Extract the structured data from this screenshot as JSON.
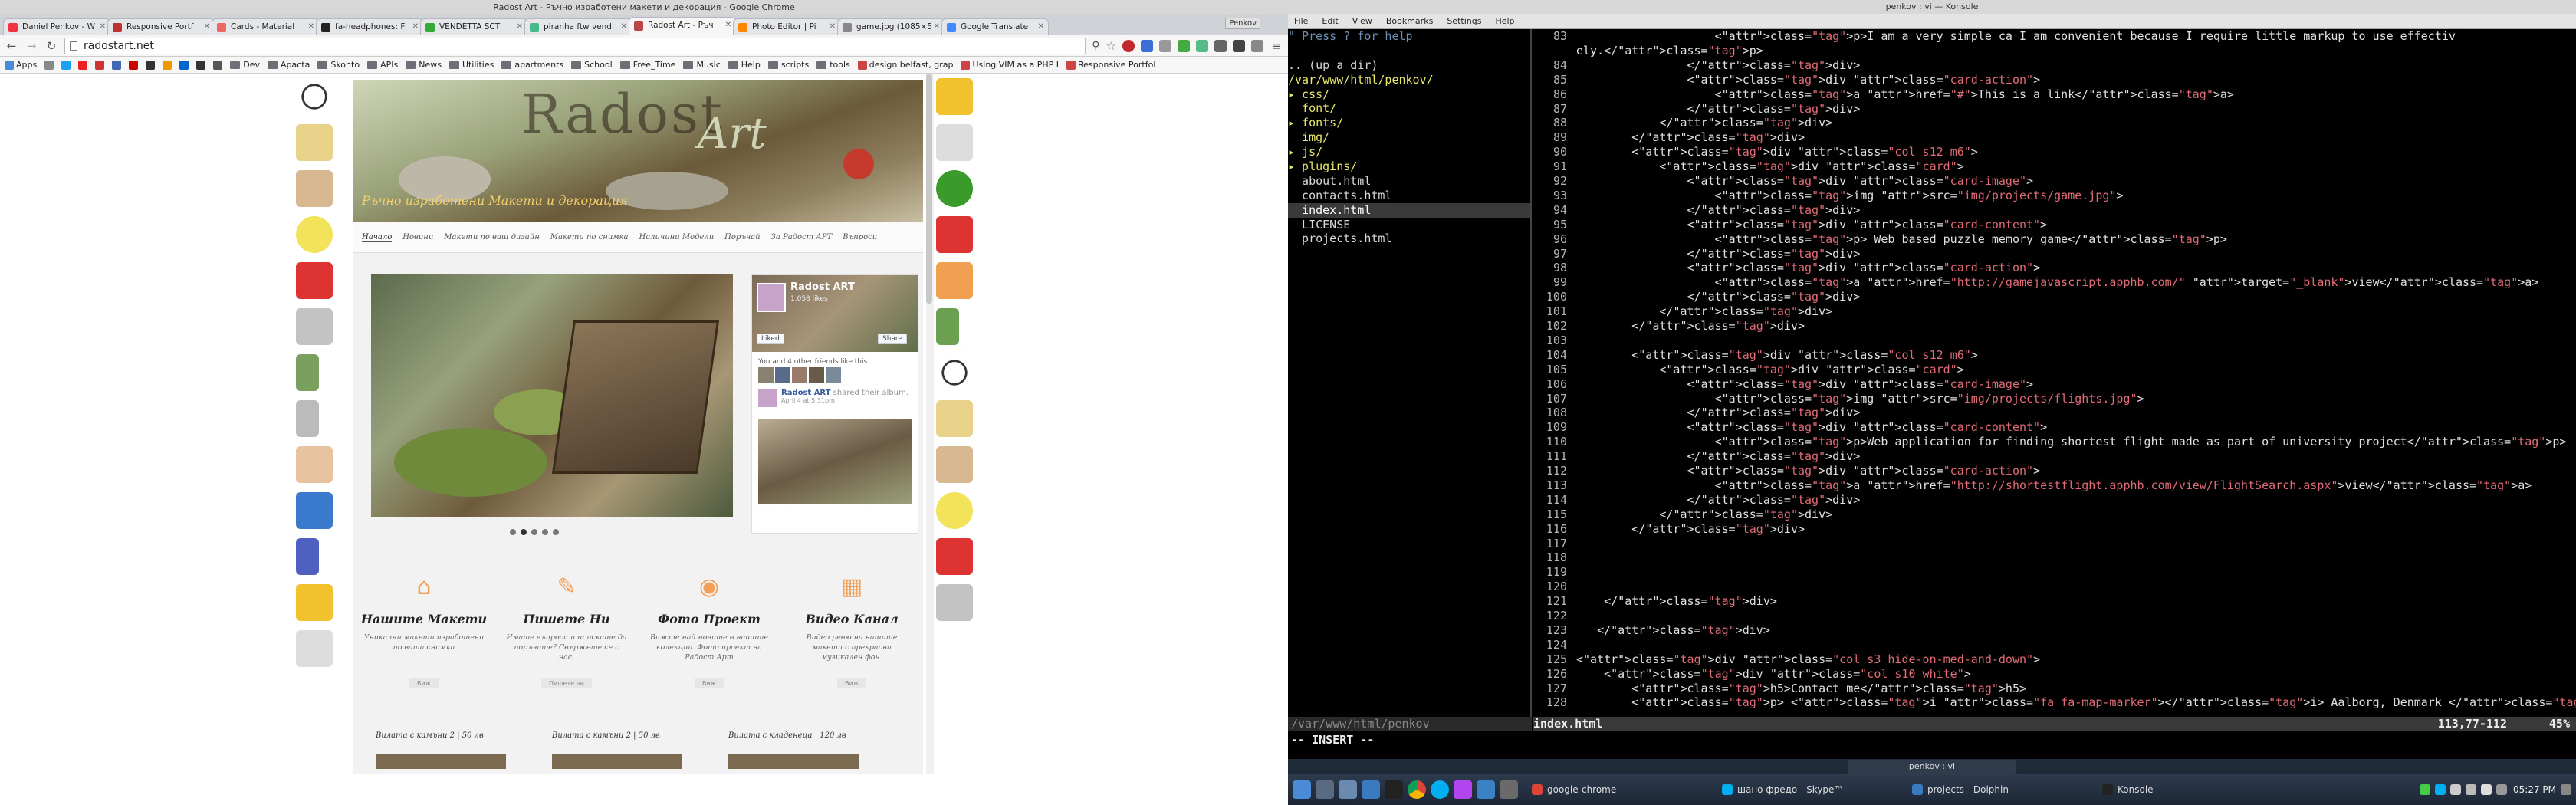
{
  "chrome": {
    "window_title": "Radost Art - Ръчно изработени макети и декорация - Google Chrome",
    "tabs": [
      {
        "label": "Daniel Penkov - W",
        "color": "#e34"
      },
      {
        "label": "Responsive Portf",
        "color": "#b33"
      },
      {
        "label": "Cards - Material",
        "color": "#e66"
      },
      {
        "label": "fa-headphones: F",
        "color": "#222"
      },
      {
        "label": "VENDETTA SCT",
        "color": "#3a3"
      },
      {
        "label": "piranha ftw vendi",
        "color": "#4b8"
      },
      {
        "label": "Radost Art - Ръч",
        "color": "#b44",
        "active": true
      },
      {
        "label": "Photo Editor | Pi",
        "color": "#f80"
      },
      {
        "label": "game.jpg (1085×5",
        "color": "#888"
      },
      {
        "label": "Google Translate",
        "color": "#48f"
      }
    ],
    "user_chip": "Penkov",
    "url": "radostart.net",
    "bookmarks": [
      "Apps",
      "Dev",
      "Apacta",
      "Skonto",
      "APIs",
      "News",
      "Utilities",
      "apartments",
      "School",
      "Free_Time",
      "Music",
      "Help",
      "scripts",
      "tools",
      "design belfast, grap",
      "Using VIM as a PHP I",
      "Responsive Portfol"
    ]
  },
  "site": {
    "brand": "Radost",
    "brand_art": "Art",
    "tagline": "Ръчно изработени Макети и декорация",
    "nav": [
      "Начало",
      "Новини",
      "Макети по ваш дизайн",
      "Макети по снимка",
      "Наличини Модели",
      "Поръчай",
      "За Радост АРТ",
      "Въпроси"
    ],
    "facebook": {
      "page_name": "Radost ART",
      "likes": "1,058 likes",
      "like_btn": "Liked",
      "share_btn": "Share",
      "friends_text": "You and 4 other friends like this",
      "post_author": "Radost ART",
      "post_action": "shared their album.",
      "post_time": "April 4 at 5:31pm"
    },
    "features": [
      {
        "icon": "home-icon",
        "title": "Нашите Макети",
        "text": "Уникални макети изработени по ваша снимка",
        "more": "Виж"
      },
      {
        "icon": "pencil-icon",
        "title": "Пишете Ни",
        "text": "Имате въпроси или искате да поръчате? Свържете се с нас.",
        "more": "Пишете ни"
      },
      {
        "icon": "camera-icon",
        "title": "Фото Проект",
        "text": "Вижте най новите в нашите колекции. Фото проект на Радост Арт",
        "more": "Виж"
      },
      {
        "icon": "film-icon",
        "title": "Видео Канал",
        "text": "Видео ревю на нашите макети с прекрасна музикален фон.",
        "more": "Виж"
      }
    ],
    "products": [
      "Вилата с камъни 2 | 50 лв",
      "Вилата с камъни 2 | 50 лв",
      "Вилата с кладенеца | 120 лв"
    ]
  },
  "konsole": {
    "window_title": "penkov : vi — Konsole",
    "menu": [
      "File",
      "Edit",
      "View",
      "Bookmarks",
      "Settings",
      "Help"
    ],
    "tree": [
      {
        "text": "\" Press ? for help",
        "cls": "comment"
      },
      {
        "text": "",
        "cls": "plain"
      },
      {
        "text": ".. (up a dir)",
        "cls": "plain"
      },
      {
        "text": "/var/www/html/penkov/",
        "cls": "dir"
      },
      {
        "text": "▸ css/",
        "cls": "dir"
      },
      {
        "text": "  font/",
        "cls": "dir"
      },
      {
        "text": "▸ fonts/",
        "cls": "dir"
      },
      {
        "text": "  img/",
        "cls": "dir"
      },
      {
        "text": "▸ js/",
        "cls": "dir"
      },
      {
        "text": "▸ plugins/",
        "cls": "dir"
      },
      {
        "text": "  about.html",
        "cls": "plain"
      },
      {
        "text": "  contacts.html",
        "cls": "plain"
      },
      {
        "text": "  index.html",
        "cls": "sel"
      },
      {
        "text": "  LICENSE",
        "cls": "plain"
      },
      {
        "text": "  projects.html",
        "cls": "plain"
      }
    ],
    "code_lines": [
      {
        "n": "83",
        "t": "                    <p>I am a very simple ca I am convenient because I require little markup to use effectiv"
      },
      {
        "n": "",
        "t": "ely.</p>"
      },
      {
        "n": "84",
        "t": "                </div>"
      },
      {
        "n": "85",
        "t": "                <div class=\"card-action\">"
      },
      {
        "n": "86",
        "t": "                    <a href=\"#\">This is a link</a>"
      },
      {
        "n": "87",
        "t": "                </div>"
      },
      {
        "n": "88",
        "t": "            </div>"
      },
      {
        "n": "89",
        "t": "        </div>"
      },
      {
        "n": "90",
        "t": "        <div class=\"col s12 m6\">"
      },
      {
        "n": "91",
        "t": "            <div class=\"card\">"
      },
      {
        "n": "92",
        "t": "                <div class=\"card-image\">"
      },
      {
        "n": "93",
        "t": "                    <img src=\"img/projects/game.jpg\">"
      },
      {
        "n": "94",
        "t": "                </div>"
      },
      {
        "n": "95",
        "t": "                <div class=\"card-content\">"
      },
      {
        "n": "96",
        "t": "                    <p> Web based puzzle memory game</p>"
      },
      {
        "n": "97",
        "t": "                </div>"
      },
      {
        "n": "98",
        "t": "                <div class=\"card-action\">"
      },
      {
        "n": "99",
        "t": "                    <a href=\"http://gamejavascript.apphb.com/\" target=\"_blank\">view</a>"
      },
      {
        "n": "100",
        "t": "                </div>"
      },
      {
        "n": "101",
        "t": "            </div>"
      },
      {
        "n": "102",
        "t": "        </div>"
      },
      {
        "n": "103",
        "t": ""
      },
      {
        "n": "104",
        "t": "        <div class=\"col s12 m6\">"
      },
      {
        "n": "105",
        "t": "            <div class=\"card\">"
      },
      {
        "n": "106",
        "t": "                <div class=\"card-image\">"
      },
      {
        "n": "107",
        "t": "                    <img src=\"img/projects/flights.jpg\">"
      },
      {
        "n": "108",
        "t": "                </div>"
      },
      {
        "n": "109",
        "t": "                <div class=\"card-content\">"
      },
      {
        "n": "110",
        "t": "                    <p>Web application for finding shortest flight made as part of university project</p>"
      },
      {
        "n": "111",
        "t": "                </div>"
      },
      {
        "n": "112",
        "t": "                <div class=\"card-action\">"
      },
      {
        "n": "113",
        "t": "                    <a href=\"http://shortestflight.apphb.com/view/FlightSearch.aspx\">view</a>"
      },
      {
        "n": "114",
        "t": "                </div>"
      },
      {
        "n": "115",
        "t": "            </div>"
      },
      {
        "n": "116",
        "t": "        </div>"
      },
      {
        "n": "117",
        "t": ""
      },
      {
        "n": "118",
        "t": ""
      },
      {
        "n": "119",
        "t": ""
      },
      {
        "n": "120",
        "t": ""
      },
      {
        "n": "121",
        "t": "    </div>"
      },
      {
        "n": "122",
        "t": ""
      },
      {
        "n": "123",
        "t": "   </div>"
      },
      {
        "n": "124",
        "t": ""
      },
      {
        "n": "125",
        "t": "<div class=\"col s3 hide-on-med-and-down\">"
      },
      {
        "n": "126",
        "t": "    <div class=\"col s10 white\">"
      },
      {
        "n": "127",
        "t": "        <h5>Contact me</h5>"
      },
      {
        "n": "128",
        "t": "        <p> <i class=\"fa fa-map-marker\"></i> Aalborg, Denmark </p>"
      }
    ],
    "status_left": "/var/www/html/penkov",
    "status_file": "index.html",
    "status_pos": "113,77-112",
    "status_pct": "45%",
    "mode": "-- INSERT --",
    "tab_label": "penkov : vi"
  },
  "taskbar": {
    "tasks": [
      "google-chrome",
      "шано фредо - Skype™",
      "projects - Dolphin",
      "Konsole"
    ],
    "clock": "05:27 PM"
  }
}
